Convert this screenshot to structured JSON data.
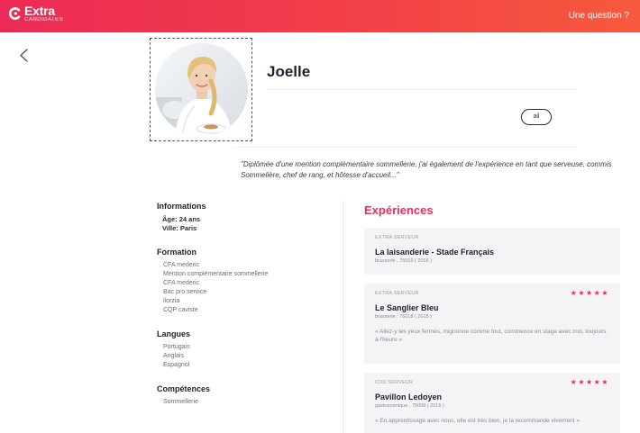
{
  "header": {
    "logo_text": "Extra",
    "logo_subtext": "candidates",
    "help_link": "Une question ?"
  },
  "profile": {
    "name": "Joelle",
    "pill_label": "ail",
    "quote": "\"Diplômée d'une mention complémentaire sommellerie, j'ai également de l'expérience en tant que serveuse, commis Sommelière, chef de rang, et hôtesse d'accueil...\""
  },
  "informations": {
    "title": "Informations",
    "lines": [
      "Âge: 24 ans",
      "Ville: Paris"
    ]
  },
  "formation": {
    "title": "Formation",
    "items": [
      "CFA mederic",
      "Mention complémentaire sommellerie",
      "CFA mederic",
      "Bac pro service",
      "ilorzia",
      "CQP caviste"
    ]
  },
  "langues": {
    "title": "Langues",
    "items": [
      "Portugais",
      "Anglais",
      "Espagnol"
    ]
  },
  "competences": {
    "title": "Compétences",
    "items": [
      "Sommellerie"
    ]
  },
  "experiences": {
    "title": "Expériences",
    "star_color": "#ee2d56",
    "cards": [
      {
        "type": "EXTRA Serveur",
        "name": "La laisanderie - Stade Français",
        "meta": "brasserie , 75016 ( 2016 )",
        "rating": 0,
        "text": ""
      },
      {
        "type": "EXTRA Serveur",
        "name": "Le Sanglier Bleu",
        "meta": "brasserie , 75018 ( 2015 )",
        "rating": 5,
        "text": "« Allez-y les yeux fermés, mignonne comme tout, commence en stage avec moi, toujours à l'heure »"
      },
      {
        "type": "CDD Serveur",
        "name": "Pavillon Ledoyen",
        "meta": "gastronomique , 75008 ( 2016 )",
        "rating": 5,
        "text": "« En apprentissage avec nous, elle est très bien, je la recommande vivement »"
      }
    ]
  }
}
